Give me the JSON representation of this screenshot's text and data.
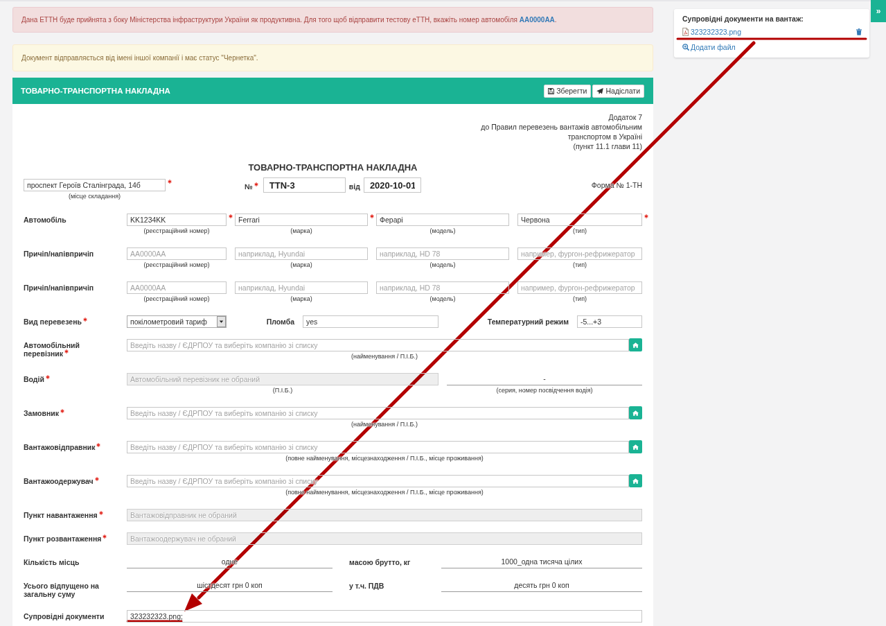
{
  "alerts": [
    {
      "kind": "danger",
      "text": "Дана ЕТТН буде прийнята з боку Міністерства інфраструктури України як продуктивна. Для того щоб відправити тестову еТТН, вкажіть номер автомобіля **AA0000AA**."
    },
    {
      "kind": "warning",
      "text": "Документ відправляється від імені іншої компанії і має статус \"Чернетка\"."
    }
  ],
  "document": {
    "title": "ТОВАРНО-ТРАНСПОРТНА НАКЛАДНА",
    "buttons": [
      {
        "label": "Зберегти"
      },
      {
        "label": "Надіслати"
      }
    ]
  },
  "form": {
    "appendix": [
      "Додаток 7",
      "до Правил перевезень вантажів автомобільним",
      "транспортом в Україні",
      "(пункт 11.1 глави 11)"
    ],
    "title": "ТОВАРНО-ТРАНСПОРТНА НАКЛАДНА",
    "place": {
      "value": "проспект Героїв Сталінграда, 14б",
      "required": true,
      "caption": "(місце складання)"
    },
    "number": {
      "label": "№",
      "required": true,
      "value": "TTN-3"
    },
    "date": {
      "label": "від",
      "value": "2020-10-01"
    },
    "form_name": "Форма № 1-ТН",
    "vehicles": [
      {
        "label": "Автомобіль",
        "fields": [
          {
            "value": "KK1234KK",
            "required": true,
            "caption": "(реєстраційний номер)"
          },
          {
            "value": "Ferrari",
            "required": true,
            "caption": "(марка)"
          },
          {
            "value": "Ферарі",
            "required": false,
            "caption": "(модель)"
          },
          {
            "value": "Червона",
            "required": true,
            "caption": "(тип)"
          }
        ]
      },
      {
        "label": "Причіп/напівпричіп",
        "fields": [
          {
            "placeholder": "AA0000AA",
            "required": false,
            "caption": "(реєстраційний номер)"
          },
          {
            "placeholder": "наприклад, Hyundai",
            "required": false,
            "caption": "(марка)"
          },
          {
            "placeholder": "наприклад, HD 78",
            "required": false,
            "caption": "(модель)"
          },
          {
            "placeholder": "например, фургон-рефрижератор",
            "required": false,
            "caption": "(тип)"
          }
        ]
      },
      {
        "label": "Причіп/напівпричіп",
        "fields": [
          {
            "placeholder": "AA0000AA",
            "required": false,
            "caption": "(реєстраційний номер)"
          },
          {
            "placeholder": "наприклад, Hyundai",
            "required": false,
            "caption": "(марка)"
          },
          {
            "placeholder": "наприклад, HD 78",
            "required": false,
            "caption": "(модель)"
          },
          {
            "placeholder": "например, фургон-рефрижератор",
            "required": false,
            "caption": "(тип)"
          }
        ]
      }
    ],
    "rows": [
      {
        "kind": "transport",
        "label": "Вид перевезень",
        "required": true,
        "select": "покілометровий тариф",
        "seal_label": "Пломба",
        "seal": "yes",
        "temperature_label": "Температурний режим",
        "temperature": "-5...+3"
      },
      {
        "kind": "company",
        "label": "Автомобільний перевізник",
        "required": true,
        "placeholder": "Введіть назву / ЄДРПОУ та виберіть компанію зі списку",
        "disabled": false,
        "caption": "(найменування / П.І.Б.)"
      },
      {
        "kind": "driver",
        "label": "Водій",
        "required": true,
        "placeholder": "Автомобільний перевізник не обраний",
        "disabled": true,
        "caption": "(П.І.Б.)",
        "license": "-",
        "license_caption": "(серия, номер посвідчення водія)"
      },
      {
        "kind": "company",
        "label": "Замовник",
        "required": true,
        "placeholder": "Введіть назву / ЄДРПОУ та виберіть компанію зі списку",
        "disabled": false,
        "caption": "(найменування / П.І.Б.)"
      },
      {
        "kind": "company",
        "label": "Вантажовідправник",
        "required": true,
        "placeholder": "Введіть назву / ЄДРПОУ та виберіть компанію зі списку",
        "disabled": false,
        "caption": "(повне найменування, місцезнаходження / П.І.Б., місце проживання)"
      },
      {
        "kind": "company",
        "label": "Вантажоодержувач",
        "required": true,
        "placeholder": "Введіть назву / ЄДРПОУ та виберіть компанію зі списку",
        "disabled": false,
        "caption": "(повне найменування, місцезнаходження / П.І.Б., місце проживання)"
      },
      {
        "kind": "point",
        "label": "Пункт навантаження",
        "required": true,
        "placeholder": "Вантажовідправник не обраний",
        "disabled": true
      },
      {
        "kind": "point",
        "label": "Пункт розвантаження",
        "required": true,
        "placeholder": "Вантажоодержувач не обраний",
        "disabled": true
      },
      {
        "kind": "pair",
        "label": "Кількість місць",
        "required": false,
        "value": "одне",
        "label_2": "масою брутто, кг",
        "value_2": "1000_одна тисяча цілих"
      },
      {
        "kind": "pair",
        "label": "Усього відпущено на загальну суму",
        "required": false,
        "value": "шістдесят грн 0 коп",
        "label_2": "у т.ч. ПДВ",
        "value_2": "десять грн 0 коп"
      },
      {
        "kind": "text",
        "label": "Супровідні документи",
        "required": false,
        "value": "323232323.png;"
      }
    ]
  },
  "attachments": {
    "title": "Супровідні документи на вантаж:",
    "files": [
      {
        "name": "323232323.png"
      }
    ],
    "add_label": "Додати файл"
  },
  "sidebar_toggle": "»"
}
